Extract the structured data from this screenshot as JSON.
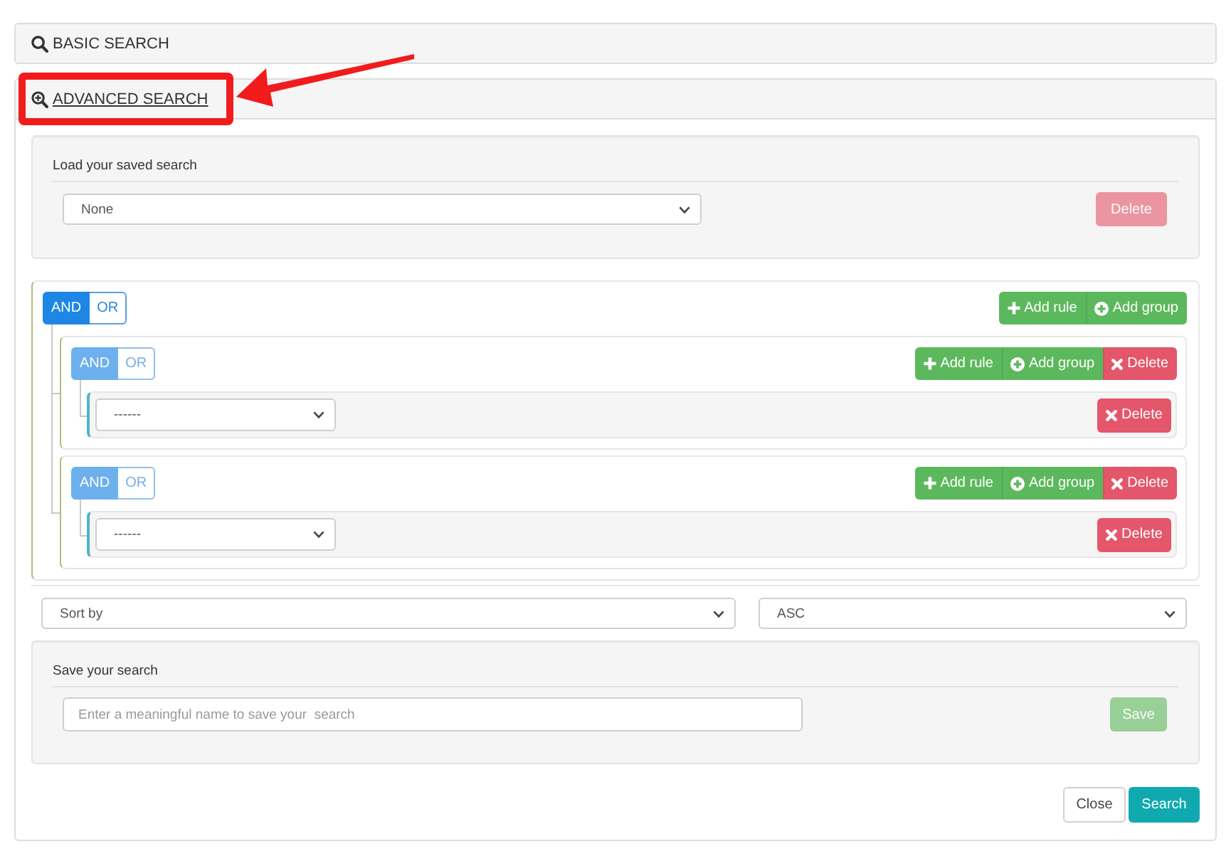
{
  "basic_search": {
    "title": "BASIC SEARCH",
    "expanded": false
  },
  "advanced_search": {
    "title": "ADVANCED SEARCH",
    "expanded": true,
    "highlighted": true,
    "saved_search": {
      "label": "Load your saved search",
      "selection": "None",
      "delete_button": {
        "label": "Delete",
        "disabled": true
      }
    },
    "query_builder": {
      "kind": "group",
      "disabled": false,
      "conditions": [
        {
          "label": "AND",
          "selected": true
        },
        {
          "label": "OR",
          "selected": false
        }
      ],
      "actions": [
        {
          "kind": "add_rule",
          "label": "Add rule"
        },
        {
          "kind": "add_group",
          "label": "Add group"
        }
      ],
      "children": [
        {
          "kind": "group",
          "disabled": true,
          "conditions": [
            {
              "label": "AND",
              "selected": true
            },
            {
              "label": "OR",
              "selected": false
            }
          ],
          "actions": [
            {
              "kind": "add_rule",
              "label": "Add rule"
            },
            {
              "kind": "add_group",
              "label": "Add group"
            },
            {
              "kind": "delete",
              "label": "Delete"
            }
          ],
          "children": [
            {
              "kind": "rule",
              "field": "------",
              "delete_label": "Delete"
            }
          ]
        },
        {
          "kind": "group",
          "disabled": true,
          "conditions": [
            {
              "label": "AND",
              "selected": true
            },
            {
              "label": "OR",
              "selected": false
            }
          ],
          "actions": [
            {
              "kind": "add_rule",
              "label": "Add rule"
            },
            {
              "kind": "add_group",
              "label": "Add group"
            },
            {
              "kind": "delete",
              "label": "Delete"
            }
          ],
          "children": [
            {
              "kind": "rule",
              "field": "------",
              "delete_label": "Delete"
            }
          ]
        }
      ]
    },
    "sort": {
      "field": "Sort by",
      "order": "ASC"
    },
    "save_search": {
      "label": "Save your search",
      "placeholder": "Enter a meaningful name to save your  search",
      "save_button": {
        "label": "Save",
        "disabled": true
      }
    },
    "buttons": [
      {
        "kind": "close",
        "label": "Close"
      },
      {
        "kind": "search",
        "label": "Search"
      }
    ]
  }
}
